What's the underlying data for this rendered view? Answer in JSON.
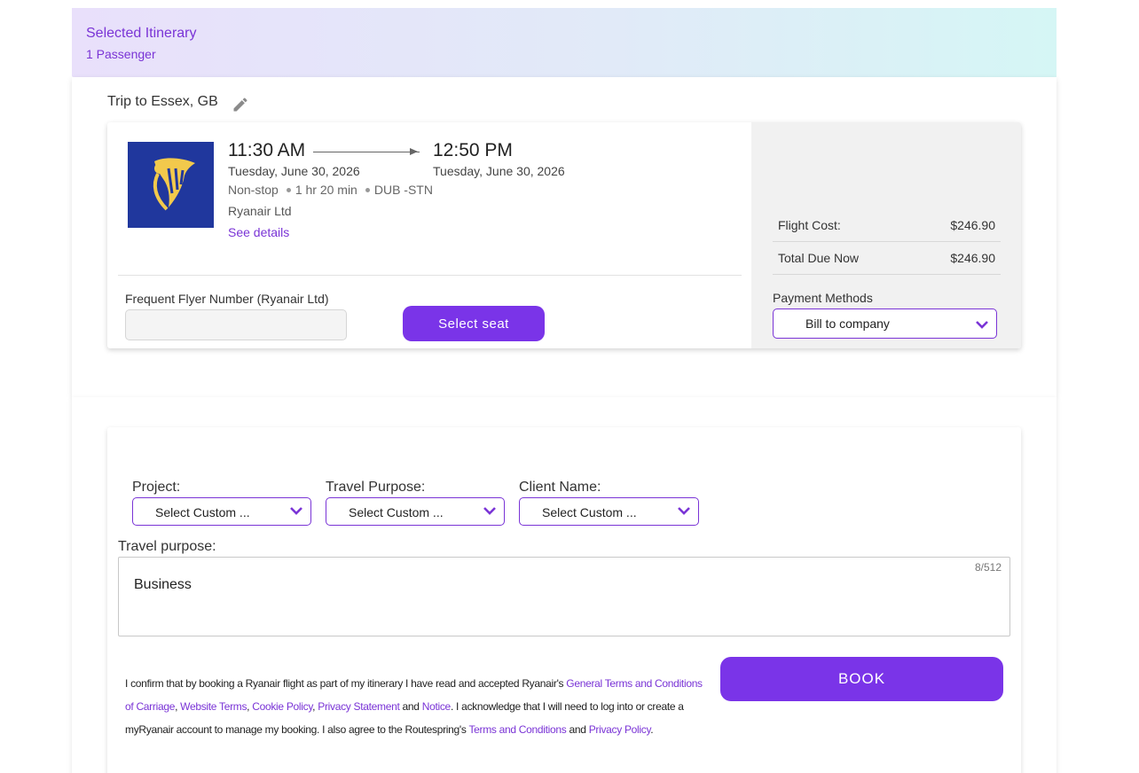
{
  "header": {
    "title": "Selected Itinerary",
    "subtitle": "1 Passenger"
  },
  "trip": {
    "title": "Trip to Essex, GB",
    "edit_icon": "pencil-icon"
  },
  "flight": {
    "departure_time": "11:30 AM",
    "departure_date": "Tuesday, June 30, 2026",
    "arrival_time": "12:50 PM",
    "arrival_date": "Tuesday, June 30, 2026",
    "stops": "Non-stop",
    "duration": "1 hr 20 min",
    "route": "DUB -STN",
    "airline": "Ryanair Ltd",
    "see_details": "See details",
    "logo_color": "#20379d",
    "logo_accent": "#f2c94c"
  },
  "frequent_flyer": {
    "label": "Frequent Flyer Number (Ryanair Ltd)",
    "value": "",
    "placeholder": ""
  },
  "seat_button": {
    "label": "Select seat"
  },
  "costs": {
    "flight_cost_label": "Flight Cost:",
    "flight_cost_value": "$246.90",
    "total_due_label": "Total Due Now",
    "total_due_value": "$246.90"
  },
  "payment": {
    "label": "Payment Methods",
    "selected": "Bill to company"
  },
  "fields": {
    "project": {
      "label": "Project:",
      "selected": "Select Custom ..."
    },
    "travel_purpose_select": {
      "label": "Travel Purpose:",
      "selected": "Select Custom ..."
    },
    "client_name": {
      "label": "Client Name:",
      "selected": "Select Custom ..."
    }
  },
  "travel_purpose": {
    "label": "Travel purpose:",
    "value": "Business",
    "count": "8/512"
  },
  "terms": {
    "t1": "I confirm that by booking a Ryanair flight as part of my itinerary I have read and accepted Ryanair's ",
    "l1": "General Terms and Conditions of Carriage",
    "s1": ", ",
    "l2": "Website Terms",
    "s2": ", ",
    "l3": "Cookie Policy",
    "s3": ", ",
    "l4": "Privacy Statement",
    "s4": " and ",
    "l5": "Notice",
    "t2": ". I acknowledge that I will need to log into or create a myRyanair account to manage my booking. I also agree to the Routespring's ",
    "l6": "Terms and Conditions",
    "s5": " and ",
    "l7": "Privacy Policy",
    "t3": "."
  },
  "book_button": {
    "label": "BOOK"
  },
  "colors": {
    "accent": "#7a34e8",
    "link": "#7a34d6"
  }
}
